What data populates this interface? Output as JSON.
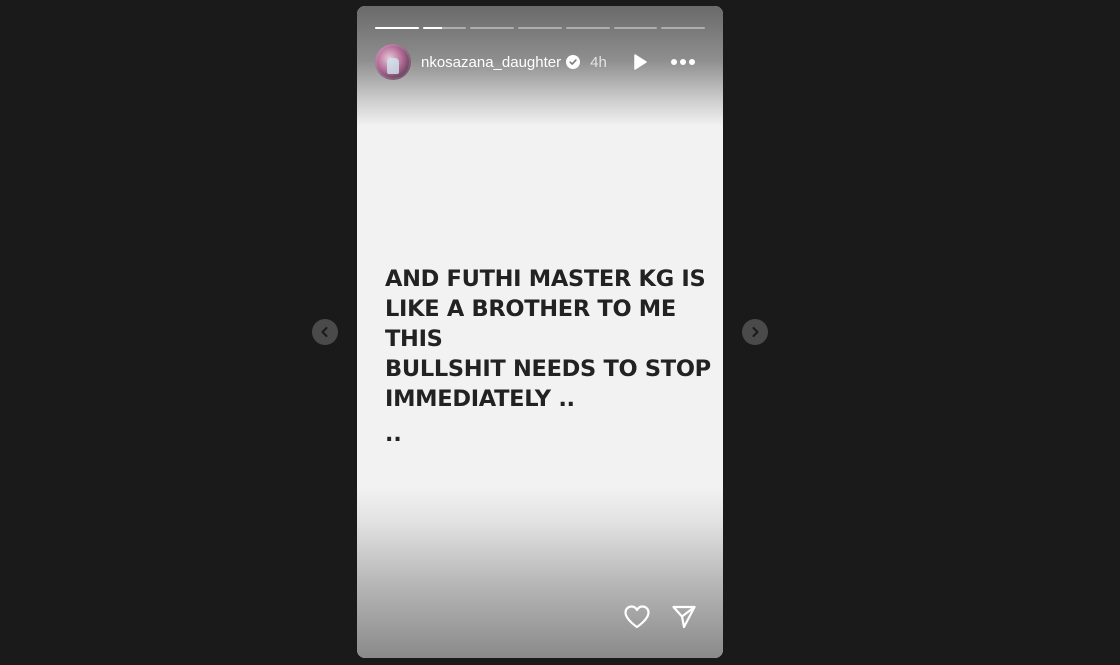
{
  "story": {
    "progress": [
      {
        "state": "seen",
        "fill": 1
      },
      {
        "state": "current",
        "fill": 0.45
      },
      {
        "state": "upcoming",
        "fill": 0
      },
      {
        "state": "upcoming",
        "fill": 0
      },
      {
        "state": "upcoming",
        "fill": 0
      },
      {
        "state": "upcoming",
        "fill": 0
      },
      {
        "state": "upcoming",
        "fill": 0
      }
    ],
    "header": {
      "username": "nkosazana_daughter",
      "verified": true,
      "timestamp": "4h",
      "play_icon": "play-icon",
      "more_icon": "more-options-icon"
    },
    "content": {
      "text": "AND FUTHI MASTER KG IS\nLIKE A BROTHER TO ME THIS\nBULLSHIT NEEDS TO STOP\nIMMEDIATELY ..",
      "trailing": ".."
    },
    "footer": {
      "like_icon": "heart-icon",
      "share_icon": "send-icon"
    }
  },
  "navigation": {
    "prev_icon": "chevron-left-icon",
    "next_icon": "chevron-right-icon"
  },
  "colors": {
    "page_background": "#1a1a1a",
    "story_background": "#f2f2f2",
    "text": "#222222",
    "nav_button": "#4a4a4a"
  }
}
